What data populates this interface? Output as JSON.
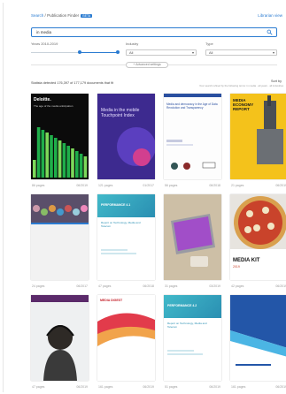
{
  "breadcrumb": {
    "home": "Search",
    "separator": "/",
    "current": "Publication Finder",
    "badge": "BETA"
  },
  "header_right": "Librarian view",
  "search": {
    "value": "in media"
  },
  "filters": {
    "years_label": "Years 2010-2019",
    "industry": {
      "label": "Industry",
      "value": "All"
    },
    "type": {
      "label": "Type",
      "value": "All"
    },
    "years_range": [
      0.55,
      0.98
    ]
  },
  "advanced_button": "+ Advanced settings",
  "results": {
    "count_text": "Statista detected 176,397 of 177,179 documents that fit",
    "count_sub": "Your search refined by the following terms: in media · all years · all industries",
    "sort_by": "Sort by"
  },
  "publications": [
    {
      "pages": "86 pages",
      "date": "06/2019",
      "cover": "deloitte",
      "cover_text": "Deloitte.",
      "cover_sub": "The age of the media anticipation"
    },
    {
      "pages": "121 pages",
      "date": "01/2017",
      "cover": "purple",
      "cover_text": "Media in the mobile Touchpoint Index",
      "cover_sub": ""
    },
    {
      "pages": "56 pages",
      "date": "06/2018",
      "cover": "whitepaper",
      "cover_text": "Media and democracy in the Age of Data Revolution and Transparency",
      "cover_sub": ""
    },
    {
      "pages": "21 pages",
      "date": "06/2019",
      "cover": "yellow",
      "cover_text": "MEDIA ECONOMY REPORT",
      "cover_sub": ""
    },
    {
      "pages": "24 pages",
      "date": "06/2017",
      "cover": "crowd",
      "cover_text": "",
      "cover_sub": ""
    },
    {
      "pages": "47 pages",
      "date": "06/2018",
      "cover": "teal",
      "cover_text": "PERFORMANCE 4.1",
      "cover_sub": "Report on Technology, Media and Telecom"
    },
    {
      "pages": "31 pages",
      "date": "03/2019",
      "cover": "laptop",
      "cover_text": "",
      "cover_sub": ""
    },
    {
      "pages": "42 pages",
      "date": "06/2019",
      "cover": "pizza",
      "cover_text": "MEDIA KIT",
      "cover_sub": "2019"
    },
    {
      "pages": "47 pages",
      "date": "06/2019",
      "cover": "headphones",
      "cover_text": "",
      "cover_sub": ""
    },
    {
      "pages": "161 pages",
      "date": "06/2019",
      "cover": "mediadigest",
      "cover_text": "MEDIA DIGEST",
      "cover_sub": ""
    },
    {
      "pages": "51 pages",
      "date": "06/2019",
      "cover": "teal2",
      "cover_text": "PERFORMANCE 4.2",
      "cover_sub": "Report on Technology, Media and Telecom"
    },
    {
      "pages": "161 pages",
      "date": "06/2019",
      "cover": "blueabstract",
      "cover_text": "",
      "cover_sub": ""
    }
  ],
  "colors": {
    "accent": "#2a7bd1",
    "border": "#c8c8c8",
    "muted": "#999999"
  }
}
